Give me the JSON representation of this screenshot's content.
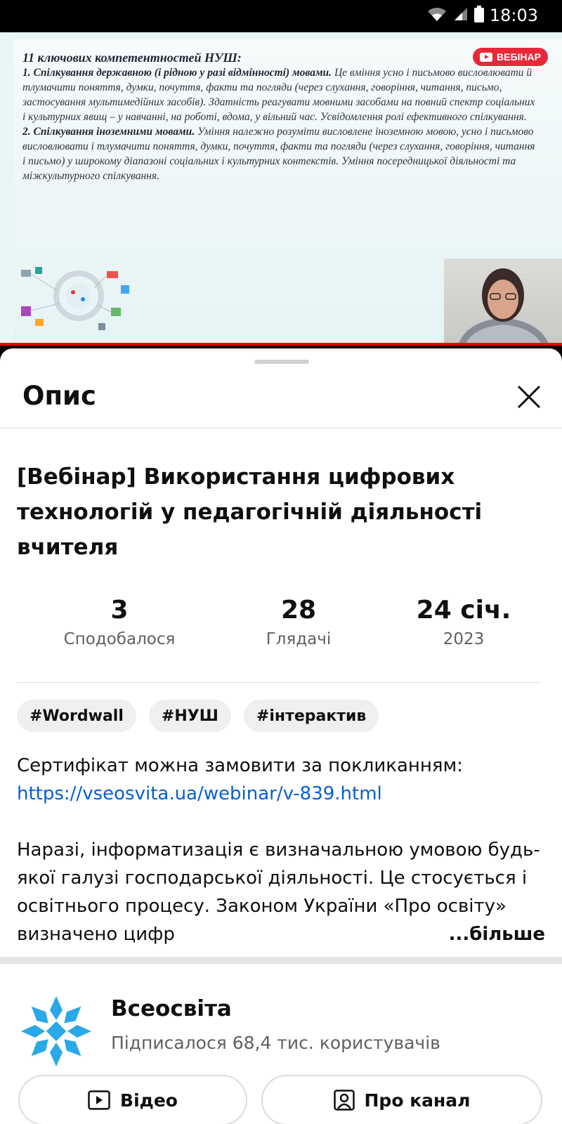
{
  "status_bar": {
    "time": "18:03"
  },
  "video": {
    "badge": "ВЕБІНАР",
    "slide_title": "11 ключових компетентностей НУШ:",
    "point1_heading": "1. Спілкування державною (і рідною у разі відмінності) мовами.",
    "point1_text": "Це вміння усно і письмово висловлювати й тлумачити поняття, думки, почуття, факти та погляди (через слухання, говоріння, читання, письмо, застосування мультимедійних засобів). Здатність реагувати мовними засобами на повний спектр соціальних і культурних явищ – у навчанні, на роботі, вдома, у вільний час. Усвідомлення ролі ефективного спілкування.",
    "point2_heading": "2. Спілкування іноземними мовами.",
    "point2_text": "Уміння належно розуміти висловлене іноземною мовою, усно і письмово висловлювати і тлумачити поняття, думки, почуття, факти та погляди (через слухання, говоріння, читання і письмо) у широкому діапазоні соціальних і культурних контекстів. Уміння посередницької діяльності та міжкультурного спілкування."
  },
  "sheet": {
    "title": "Опис",
    "video_title": "[Вебінар] Використання цифрових технологій у педагогічній діяльності вчителя",
    "stats": {
      "likes_value": "3",
      "likes_label": "Сподобалося",
      "views_value": "28",
      "views_label": "Глядачі",
      "date_value": "24 січ.",
      "date_year": "2023"
    },
    "tags": [
      "#Wordwall",
      "#НУШ",
      "#інтерактив"
    ],
    "description": {
      "certificate_text": "Сертифікат можна замовити за покликанням:",
      "link": "https://vseosvita.ua/webinar/v-839.html",
      "body": "Наразі, інформатизація є визначальною умовою будь-якої галузі господарської діяльності. Це стосується і освітнього процесу. Законом України «Про освіту» визначено цифр",
      "more_label": "...більше"
    }
  },
  "channel": {
    "name": "Всеосвіта",
    "subscribers": "Підписалося 68,4 тис. користувачів",
    "videos_button": "Відео",
    "about_button": "Про канал"
  },
  "colors": {
    "accent_red": "#e8283a",
    "link_blue": "#065fd4",
    "logo_blue": "#2aa8e8"
  }
}
